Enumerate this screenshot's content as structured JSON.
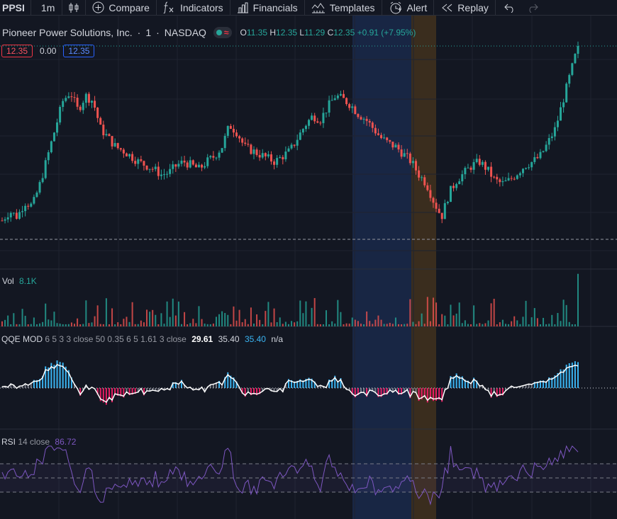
{
  "toolbar": {
    "symbol": "PPSI",
    "interval": "1m",
    "compare": "Compare",
    "indicators": "Indicators",
    "financials": "Financials",
    "templates": "Templates",
    "alert": "Alert",
    "replay": "Replay"
  },
  "legend": {
    "title": "Pioneer Power Solutions, Inc.",
    "interval": "1",
    "exchange": "NASDAQ",
    "o_label": "O",
    "o": "11.35",
    "h_label": "H",
    "h": "12.35",
    "l_label": "L",
    "l": "11.29",
    "c_label": "C",
    "c": "12.35",
    "change": "+0.91 (+7.95%)"
  },
  "price_tags": {
    "left": "12.35",
    "mid": "0.00",
    "right": "12.35"
  },
  "volume": {
    "label": "Vol",
    "value": "8.1K"
  },
  "qqe": {
    "label": "QQE MOD",
    "params": "6 5 3 3 close 50 0.35 6 5 1.61 3 close",
    "v1": "29.61",
    "v2": "35.40",
    "v3": "35.40",
    "v4": "n/a"
  },
  "rsi": {
    "label": "RSI",
    "params": "14 close",
    "value": "86.72"
  },
  "colors": {
    "bg": "#131722",
    "up": "#26a69a",
    "down": "#ef5350",
    "qqe_blue": "#3ab4f2",
    "qqe_red": "#e91e63",
    "qqe_grey": "#787b86",
    "rsi": "#7e57c2",
    "highlight_blue": "#1e3a6e",
    "highlight_orange": "#6b4a1a"
  },
  "icons": [
    "candles-icon",
    "plus-circle-icon",
    "fx-icon",
    "financials-icon",
    "templates-icon",
    "alert-clock-icon",
    "replay-icon",
    "undo-icon",
    "redo-icon"
  ],
  "chart_data": {
    "type": "candlestick",
    "price_min": 11.29,
    "price_max": 12.35,
    "close_path": [
      11.4,
      11.45,
      11.42,
      11.5,
      11.48,
      11.6,
      11.75,
      11.9,
      12.05,
      12.1,
      12.0,
      12.08,
      12.05,
      11.9,
      11.85,
      11.8,
      11.78,
      11.75,
      11.72,
      11.7,
      11.68,
      11.65,
      11.66,
      11.7,
      11.72,
      11.7,
      11.68,
      11.72,
      11.75,
      11.8,
      11.92,
      11.88,
      11.8,
      11.78,
      11.76,
      11.74,
      11.72,
      11.75,
      11.78,
      11.85,
      11.92,
      11.97,
      11.95,
      12.02,
      12.08,
      12.06,
      12.03,
      11.98,
      11.95,
      11.9,
      11.85,
      11.82,
      11.8,
      11.76,
      11.72,
      11.65,
      11.6,
      11.5,
      11.42,
      11.55,
      11.62,
      11.66,
      11.7,
      11.72,
      11.68,
      11.62,
      11.6,
      11.62,
      11.66,
      11.7,
      11.72,
      11.75,
      11.82,
      11.9,
      12.05,
      12.2,
      12.35
    ],
    "rsi_levels": [
      70,
      50,
      30
    ]
  }
}
